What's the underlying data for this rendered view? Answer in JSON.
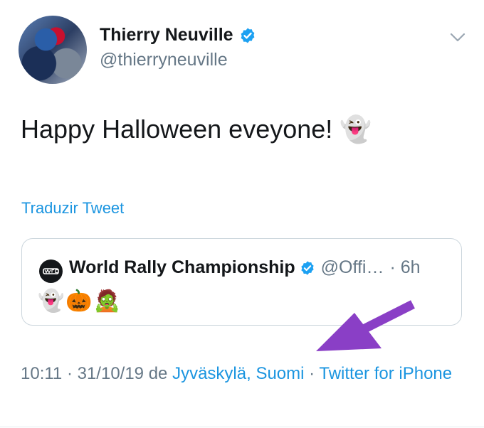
{
  "author": {
    "name": "Thierry Neuville",
    "handle": "@thierryneuville"
  },
  "tweet": {
    "text": "Happy Halloween eveyone!",
    "emoji": "👻",
    "translate_label": "Traduzir Tweet"
  },
  "quoted": {
    "name": "World Rally Championship",
    "handle": "@Offi…",
    "time": "· 6h",
    "emojis": "👻🎃🧟"
  },
  "meta": {
    "time": "10:11",
    "date": "31/10/19",
    "from_label": "de",
    "location": "Jyväskylä, Suomi",
    "client": "Twitter for iPhone"
  },
  "colors": {
    "link": "#1b95e0",
    "secondary": "#657786",
    "arrow": "#8a3fc6"
  }
}
